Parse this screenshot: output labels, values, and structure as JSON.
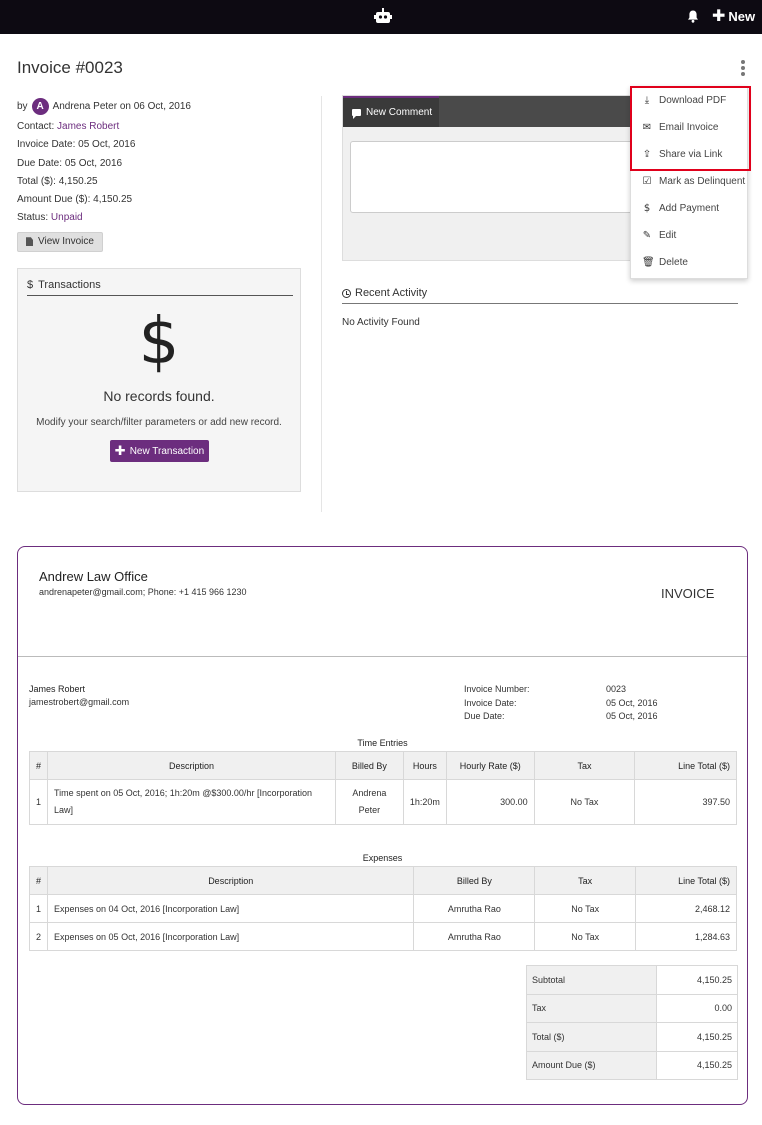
{
  "topbar": {
    "logo_icon": "robot-logo-icon",
    "bell_icon": "bell-icon",
    "new_label": "New"
  },
  "page": {
    "title": "Invoice #0023"
  },
  "info": {
    "by_prefix": "by",
    "avatar_letter": "A",
    "author_line": "Andrena Peter on 06 Oct, 2016",
    "contact_label": "Contact:",
    "contact_value": "James Robert",
    "invoice_date_label": "Invoice Date:",
    "invoice_date_value": "05 Oct, 2016",
    "due_date_label": "Due Date:",
    "due_date_value": "05 Oct, 2016",
    "total_label": "Total ($):",
    "total_value": "4,150.25",
    "amount_due_label": "Amount Due ($):",
    "amount_due_value": "4,150.25",
    "status_label": "Status:",
    "status_value": "Unpaid",
    "view_invoice_label": "View Invoice"
  },
  "transactions": {
    "title": "Transactions",
    "icon_glyph": "$",
    "empty_title": "No records found.",
    "empty_sub": "Modify your search/filter parameters or add new record.",
    "new_button": "New Transaction"
  },
  "comment": {
    "tab_label": "New Comment",
    "textarea_value": ""
  },
  "activity": {
    "title": "Recent Activity",
    "empty": "No Activity Found"
  },
  "menu": {
    "items": [
      {
        "label": "Download PDF",
        "icon": "download-icon",
        "glyph": "⤓"
      },
      {
        "label": "Email Invoice",
        "icon": "email-icon",
        "glyph": "✉"
      },
      {
        "label": "Share via Link",
        "icon": "share-icon",
        "glyph": "⇪"
      },
      {
        "label": "Mark as Delinquent",
        "icon": "checkbox-icon",
        "glyph": "☑"
      },
      {
        "label": "Add Payment",
        "icon": "dollar-icon",
        "glyph": "$"
      },
      {
        "label": "Edit",
        "icon": "pencil-icon",
        "glyph": "✎"
      },
      {
        "label": "Delete",
        "icon": "trash-icon",
        "glyph": "🗑"
      }
    ],
    "highlight_color": "#e0001b"
  },
  "invoice": {
    "company": "Andrew Law Office",
    "company_contact": "andrenapeter@gmail.com; Phone: +1 415 966 1230",
    "doc_label": "INVOICE",
    "client_name": "James Robert",
    "client_email": "jamestrobert@gmail.com",
    "meta": [
      {
        "k": "Invoice Number:",
        "v": "0023"
      },
      {
        "k": "Invoice Date:",
        "v": "05 Oct, 2016"
      },
      {
        "k": "Due Date:",
        "v": "05 Oct, 2016"
      }
    ],
    "time_entries": {
      "title": "Time Entries",
      "headers": [
        "#",
        "Description",
        "Billed By",
        "Hours",
        "Hourly Rate ($)",
        "Tax",
        "Line Total ($)"
      ],
      "rows": [
        {
          "num": "1",
          "desc": "Time spent on 05 Oct, 2016; 1h:20m @$300.00/hr [Incorporation Law]",
          "billed_by": "Andrena Peter",
          "hours": "1h:20m",
          "rate": "300.00",
          "tax": "No Tax",
          "total": "397.50"
        }
      ]
    },
    "expenses": {
      "title": "Expenses",
      "headers": [
        "#",
        "Description",
        "Billed By",
        "Tax",
        "Line Total ($)"
      ],
      "rows": [
        {
          "num": "1",
          "desc": "Expenses on 04 Oct, 2016 [Incorporation Law]",
          "billed_by": "Amrutha Rao",
          "tax": "No Tax",
          "total": "2,468.12"
        },
        {
          "num": "2",
          "desc": "Expenses on 05 Oct, 2016 [Incorporation Law]",
          "billed_by": "Amrutha Rao",
          "tax": "No Tax",
          "total": "1,284.63"
        }
      ]
    },
    "totals": [
      {
        "k": "Subtotal",
        "v": "4,150.25"
      },
      {
        "k": "Tax",
        "v": "0.00"
      },
      {
        "k": "Total ($)",
        "v": "4,150.25"
      },
      {
        "k": "Amount Due ($)",
        "v": "4,150.25"
      }
    ]
  },
  "colors": {
    "brand": "#6c2d7e",
    "topbar": "#0d0a12"
  }
}
